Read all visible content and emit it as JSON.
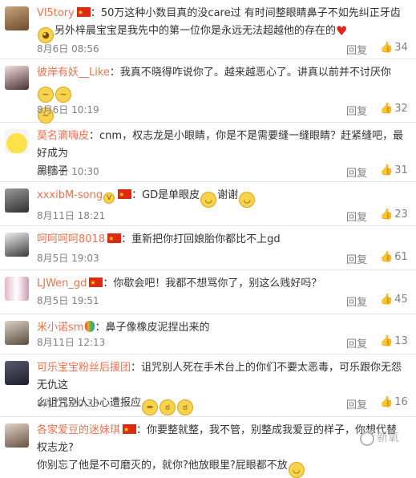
{
  "reply_label": "回复",
  "watermark": "新氧",
  "comments": [
    {
      "user": "Vl5tory",
      "text1": "：50万这种小数目真的没care过 有时间整眼睛鼻子不如先纠正牙齿",
      "text2": "另外梓晨宝宝是我先中的第一位你是永远无法超越他的存在的",
      "time": "8月6日 08:56",
      "likes": "34"
    },
    {
      "user": "彼岸有妖__Like",
      "text1": "：我真不晓得咋说你了。越来越恶心了。讲真以前并不讨厌你",
      "time": "8月6日 10:19",
      "likes": "32"
    },
    {
      "user": "莫名滴嗨皮",
      "text1": "：cnm，权志龙是小眼睛，你是不是需要缝一缝眼睛？赶紧缝吧，最好成为",
      "text2": "黑瞎子",
      "time": "8月6日 10:30",
      "likes": "31"
    },
    {
      "user": "xxxibM-song",
      "text1": "：GD是单眼皮",
      "text2": "谢谢",
      "time": "8月11日 18:21",
      "likes": "23"
    },
    {
      "user": "呵呵呵呵8018",
      "text1": "：重新把你打回娘胎你都比不上gd",
      "time": "8月5日 19:03",
      "likes": "61"
    },
    {
      "user": "LJWen_gd",
      "text1": "：你歇会吧！我都不想骂你了，别这么贱好吗？",
      "time": "8月5日 19:51",
      "likes": "45"
    },
    {
      "user": "米小诺sm",
      "text1": "：鼻子像橡皮泥捏出来的",
      "time": "8月11日 12:13",
      "likes": "13"
    },
    {
      "user": "可乐宝宝粉丝后援团",
      "text1": "：诅咒别人死在手术台上的你们不要太恶毒，可乐跟你无怨无仇这",
      "text2": "么诅咒别人小心遭报应",
      "time": "8月7日 20:33",
      "likes": "16"
    },
    {
      "user": "各家爱豆的迷妹琪",
      "text1": "：你要整就整，我不管，别整成我爱豆的样子，你想代替权志龙?",
      "text2": "你别忘了他是不可磨灭的，就你?他放眼里?屁眼都不放"
    }
  ]
}
